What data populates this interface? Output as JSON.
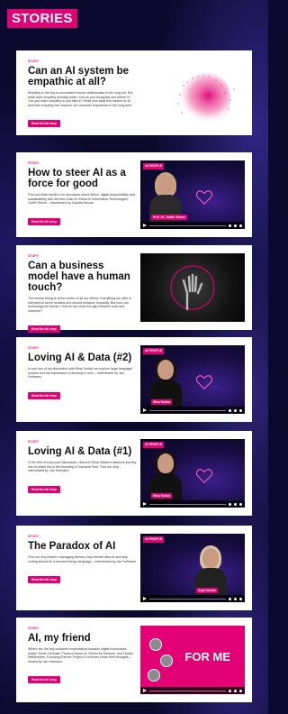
{
  "header": {
    "title": "STORIES"
  },
  "stories": [
    {
      "kicker": "STORY",
      "title": "Can an AI system be empathic at all?",
      "description": "Empathy is the key to successful human relationships in the long run. But what does empathy actually mean, how do you recognize and define it? Can you learn empathy or just fake it? Read how what this means for AI and how empathy can improve our customer experience in the long term.",
      "button": "Read the full story"
    },
    {
      "kicker": "STORY",
      "title": "How to steer AI as a force for good",
      "description": "Find out what needs to be discussed about ethics, digital responsibility and sustainability with the first Chair for Ethics in Information Technologies, Judith Simon – interviewed by Claudia Nemat.",
      "button": "Read the full story",
      "media": {
        "badge": "AI PEOPLE",
        "name_tag": "Prof. Dr. Judith Simon"
      }
    },
    {
      "kicker": "STORY",
      "title": "Can a business model have a human touch?",
      "description": "The human being is at the center of all our efforts. Everything we offer is intended to serve humans and should enhance humanity. But how can technology be human? How do we close the gap between man and machine?",
      "button": "Read the full story"
    },
    {
      "kicker": "STORY",
      "title": "Loving AI & Data (#2)",
      "description": "In part two of my discussion with Mina Saidze we explore large language models and the importance of diversity in tech – interviewed by Jan Hofmann.",
      "button": "Read the full story",
      "media": {
        "badge": "AI PEOPLE",
        "name_tag": "Mina Saidze"
      }
    },
    {
      "kicker": "STORY",
      "title": "Loving AI & Data (#1)",
      "description": "In the first of a two-part discussion, discover Mina Saidze's fabulous journey into AI which led to the founding of Inclusive Tech. Find out why – interviewed by Jan Hofmann.",
      "button": "Read the full story",
      "media": {
        "badge": "AI PEOPLE",
        "name_tag": "Mina Saidze"
      }
    },
    {
      "kicker": "STORY",
      "title": "The Paradox of AI",
      "description": "Find out why Bosch's managing director Anja Hendel likes AI and why coding should be a second foreign language – interviewed by Jan Hofmann.",
      "button": "Read the full story",
      "media": {
        "badge": "AI PEOPLE",
        "name_tag": "Anja Hendel"
      }
    },
    {
      "kicker": "STORY",
      "title": "AI, my friend",
      "description": "Where are the key customer expectations towards digital businesses today? Sören Schmidt, Product Owner AI, Deutsche Telekom, and Florian Weisemann, Founding Partner Project A Ventures share their thoughts – hosted by Jan Hofmann.",
      "button": "Read the full story",
      "media": {
        "title": "FOR ME"
      }
    }
  ],
  "colors": {
    "brand": "#e20074",
    "background": "#0b0a2e"
  }
}
